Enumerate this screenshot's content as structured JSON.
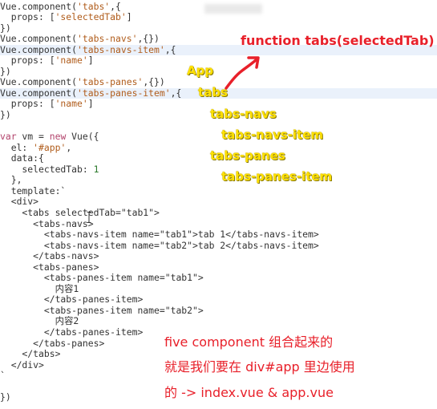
{
  "code_lines": [
    "Vue.component('tabs',{",
    "  props: ['selectedTab']",
    "})",
    "Vue.component('tabs-navs',{})",
    "Vue.component('tabs-navs-item',{",
    "  props: ['name']",
    "})",
    "Vue.component('tabs-panes',{})",
    "Vue.component('tabs-panes-item',{",
    "  props: ['name']",
    "})",
    "",
    "var vm = new Vue({",
    "  el: '#app',",
    "  data:{",
    "    selectedTab: 1",
    "  },",
    "  template:`",
    "  <div>",
    "    <tabs selectedTab=\"tab1\">",
    "      <tabs-navs>",
    "        <tabs-navs-item name=\"tab1\">tab 1</tabs-navs-item>",
    "        <tabs-navs-item name=\"tab2\">tab 2</tabs-navs-item>",
    "      </tabs-navs>",
    "      <tabs-panes>",
    "        <tabs-panes-item name=\"tab1\">",
    "          内容1",
    "        </tabs-panes-item>",
    "        <tabs-panes-item name=\"tab2\">",
    "          内容2",
    "        </tabs-panes-item>",
    "      </tabs-panes>",
    "    </tabs>",
    "  </div>",
    "`",
    "",
    "})"
  ],
  "annotations": {
    "function_label": "function tabs(selectedTab)",
    "tree": {
      "app": "App",
      "tabs": "tabs",
      "tabs_navs": "tabs-navs",
      "tabs_navs_item": "tabs-navs-item",
      "tabs_panes": "tabs-panes",
      "tabs_panes_item": "tabs-panes-item"
    },
    "note_line1": "five component 组合起来的",
    "note_line2": "就是我们要在 div#app 里边使用",
    "note_line3": "的 -> index.vue & app.vue"
  },
  "colors": {
    "annotation_red": "#e8202a",
    "annotation_yellow": "#ffe100",
    "highlight": "#eaf1fb"
  },
  "icons": [
    "arrow-up-right-icon",
    "text-cursor-icon"
  ]
}
